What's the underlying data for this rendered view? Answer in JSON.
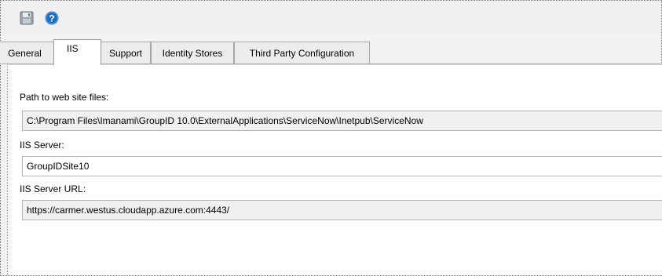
{
  "tabs": [
    {
      "label": "General"
    },
    {
      "label": "IIS"
    },
    {
      "label": "Support"
    },
    {
      "label": "Identity Stores"
    },
    {
      "label": "Third Party Configuration"
    }
  ],
  "active_tab": "IIS",
  "toolbar": {
    "save_icon": "save-icon",
    "help_icon": "help-icon",
    "help_color": "#1e6fbf"
  },
  "fields": {
    "path": {
      "label": "Path to web site files:",
      "value": "C:\\Program Files\\Imanami\\GroupID 10.0\\ExternalApplications\\ServiceNow\\Inetpub\\ServiceNow"
    },
    "server": {
      "label": "IIS Server:",
      "value": "GroupIDSite10"
    },
    "url": {
      "label": "IIS Server URL:",
      "value": "https://carmer.westus.cloudapp.azure.com:4443/"
    }
  }
}
